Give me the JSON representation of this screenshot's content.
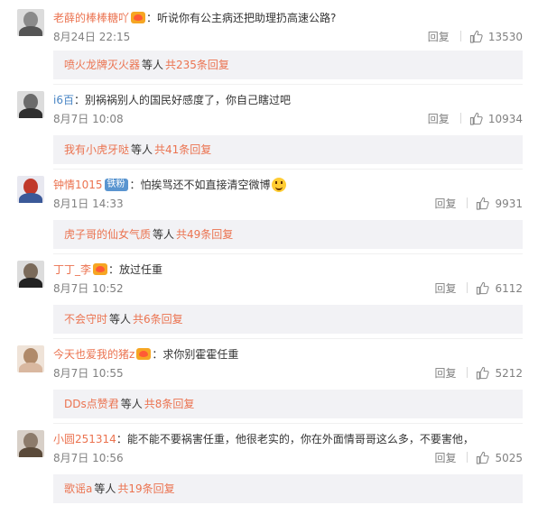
{
  "colors": {
    "name": "#eb7350",
    "link_blue": "#4a86c5",
    "text": "#333333",
    "meta": "#808080",
    "subreply_bg": "#f2f2f5"
  },
  "reply_label": "回复",
  "comments": [
    {
      "name": "老薛的棒棒糖吖",
      "badge": "vip",
      "text": "：听说你有公主病还把助理扔高速公路?",
      "time": "8月24日 22:15",
      "likes": "13530",
      "sub": {
        "name": "喷火龙牌灭火器",
        "mid": "等人",
        "more": "共235条回复"
      }
    },
    {
      "name": "i6百",
      "badge": "",
      "text": "：别祸祸别人的国民好感度了，你自己瞎过吧",
      "time": "8月7日 10:08",
      "likes": "10934",
      "sub": {
        "name": "我有小虎牙哒",
        "mid": "等人",
        "more": "共41条回复"
      }
    },
    {
      "name": "钟情1015",
      "badge": "fan",
      "fan_label": "铁粉",
      "text": "：怕挨骂还不如直接清空微博",
      "time": "8月1日 14:33",
      "likes": "9931",
      "sub": {
        "name": "虎子哥的仙女气质",
        "mid": "等人",
        "more": "共49条回复"
      }
    },
    {
      "name": "丁丁_李",
      "badge": "vip",
      "text": "：放过任重",
      "time": "8月7日 10:52",
      "likes": "6112",
      "sub": {
        "name": "不会守时",
        "mid": "等人",
        "more": "共6条回复"
      }
    },
    {
      "name": "今天也爱我的猪z",
      "badge": "vip",
      "text": "：求你别霍霍任重",
      "time": "8月7日 10:55",
      "likes": "5212",
      "sub": {
        "name": "DDs点赞君",
        "mid": "等人",
        "more": "共8条回复"
      }
    },
    {
      "name": "小圆251314",
      "badge": "",
      "text": "：能不能不要祸害任重，他很老实的，你在外面情哥哥这么多，不要害他，",
      "time": "8月7日 10:56",
      "likes": "5025",
      "sub": {
        "name": "歌谣a",
        "mid": "等人",
        "more": "共19条回复"
      }
    }
  ]
}
